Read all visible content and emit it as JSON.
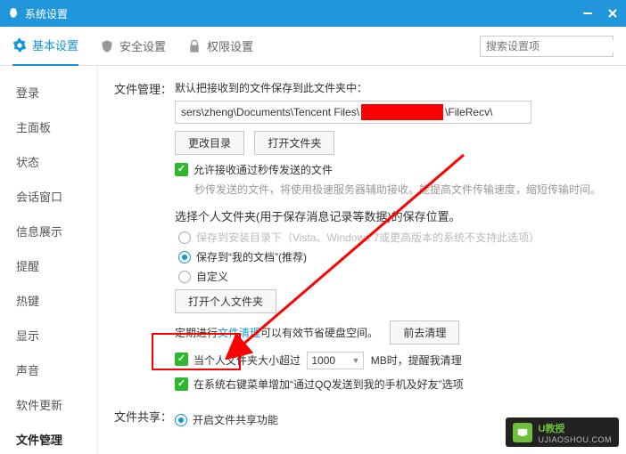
{
  "window": {
    "title": "系统设置"
  },
  "tabs": {
    "basic": "基本设置",
    "security": "安全设置",
    "permission": "权限设置"
  },
  "search": {
    "placeholder": "搜索设置项"
  },
  "sidebar": {
    "items": [
      "登录",
      "主面板",
      "状态",
      "会话窗口",
      "信息展示",
      "提醒",
      "热键",
      "显示",
      "声音",
      "软件更新",
      "文件管理"
    ],
    "selected_index": 10
  },
  "file_mgmt": {
    "section_label": "文件管理：",
    "default_path_label": "默认把接收到的文件保存到此文件夹中：",
    "path_part1": "sers\\zheng\\Documents\\Tencent Files\\",
    "path_part2": "\\FileRecv\\",
    "change_dir_btn": "更改目录",
    "open_folder_btn": "打开文件夹",
    "allow_flash_label": "允许接收通过秒传发送的文件",
    "flash_hint": "秒传发送的文件，将使用极速服务器辅助接收。能提高文件传输速度，缩短传输时间。",
    "personal_folder_label": "选择个人文件夹(用于保存消息记录等数据)的保存位置。",
    "radio_install": "保存到安装目录下（Vista、Windows 7或更高版本的系统不支持此选项）",
    "radio_mydocs": "保存到“我的文档”(推荐)",
    "radio_custom": "自定义",
    "open_personal_btn": "打开个人文件夹",
    "cleanup_text_1": "定期进行",
    "cleanup_link": "文件清理",
    "cleanup_text_2": "可以有效节省硬盘空间。",
    "cleanup_btn": "前去清理",
    "size_warn_1": "当个人文件夹大小超过",
    "size_value": "1000",
    "size_warn_2": "MB时，提醒我清理",
    "context_menu_label": "在系统右键菜单增加“通过QQ发送到我的手机及好友”选项"
  },
  "file_share": {
    "section_label": "文件共享：",
    "enable_label": "开启文件共享功能"
  },
  "watermark": {
    "name": "U教授",
    "sub": "UJIAOSHOU.COM"
  }
}
